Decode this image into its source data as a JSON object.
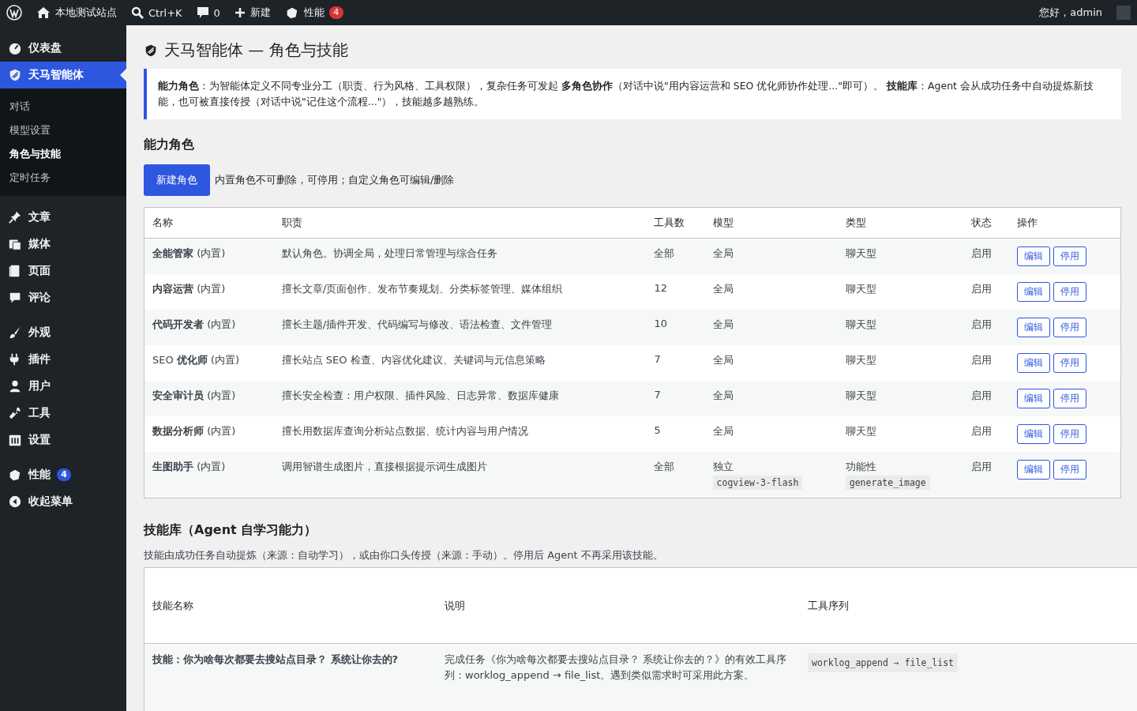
{
  "admin_bar": {
    "site_name": "本地测试站点",
    "search_shortcut": "Ctrl+K",
    "comments_count": "0",
    "new_label": "新建",
    "performance_label": "性能",
    "performance_badge": "4",
    "greeting": "您好，admin"
  },
  "sidebar": {
    "sections": [
      {
        "items": [
          {
            "label": "仪表盘",
            "selected": false
          },
          {
            "label": "天马智能体",
            "selected": true,
            "children": [
              {
                "label": "对话",
                "selected": false
              },
              {
                "label": "模型设置",
                "selected": false
              },
              {
                "label": "角色与技能",
                "selected": true
              },
              {
                "label": "定时任务",
                "selected": false
              }
            ]
          }
        ]
      },
      {
        "items": [
          {
            "label": "文章",
            "selected": false
          },
          {
            "label": "媒体",
            "selected": false
          },
          {
            "label": "页面",
            "selected": false
          },
          {
            "label": "评论",
            "selected": false
          }
        ]
      },
      {
        "items": [
          {
            "label": "外观",
            "selected": false
          },
          {
            "label": "插件",
            "selected": false
          },
          {
            "label": "用户",
            "selected": false
          },
          {
            "label": "工具",
            "selected": false
          },
          {
            "label": "设置",
            "selected": false
          }
        ]
      },
      {
        "items": [
          {
            "label": "性能",
            "selected": false,
            "badge": "4"
          },
          {
            "label": "收起菜单",
            "selected": false
          }
        ]
      }
    ]
  },
  "page": {
    "title": "天马智能体 — 角色与技能",
    "notice": "**能力角色**：为智能体定义不同专业分工（职责、行为风格、工具权限），复杂任务可发起 **多角色协作**（对话中说\"用内容运营和 SEO 优化师协作处理...\"即可）。 **技能库**：Agent 会从成功任务中自动提炼新技能，也可被直接传授（对话中说\"记住这个流程...\"），技能越多越熟练。",
    "roles_heading": "能力角色",
    "new_role_button": "新建角色",
    "roles_hint": "内置角色不可删除，可停用；自定义角色可编辑/删除",
    "roles_table": {
      "columns": [
        "名称",
        "职责",
        "工具数",
        "模型",
        "类型",
        "状态",
        "操作"
      ],
      "rows": [
        {
          "name": "**全能管家** (内置)",
          "duty": "默认角色。协调全局，处理日常管理与综合任务",
          "tools": "全部",
          "model": "全局",
          "type": "聊天型",
          "status": "启用",
          "edit": "编辑",
          "disable": "停用"
        },
        {
          "name": "**内容运营** (内置)",
          "duty": "擅长文章/页面创作、发布节奏规划、分类标签管理、媒体组织",
          "tools": "12",
          "model": "全局",
          "type": "聊天型",
          "status": "启用",
          "edit": "编辑",
          "disable": "停用"
        },
        {
          "name": "**代码开发者** (内置)",
          "duty": "擅长主题/插件开发、代码编写与修改、语法检查、文件管理",
          "tools": "10",
          "model": "全局",
          "type": "聊天型",
          "status": "启用",
          "edit": "编辑",
          "disable": "停用"
        },
        {
          "name": "SEO **优化师** (内置)",
          "duty": "擅长站点 SEO 检查、内容优化建议、关键词与元信息策略",
          "tools": "7",
          "model": "全局",
          "type": "聊天型",
          "status": "启用",
          "edit": "编辑",
          "disable": "停用"
        },
        {
          "name": "**安全审计员** (内置)",
          "duty": "擅长安全检查：用户权限、插件风险、日志异常、数据库健康",
          "tools": "7",
          "model": "全局",
          "type": "聊天型",
          "status": "启用",
          "edit": "编辑",
          "disable": "停用"
        },
        {
          "name": "**数据分析师** (内置)",
          "duty": "擅长用数据库查询分析站点数据、统计内容与用户情况",
          "tools": "5",
          "model": "全局",
          "type": "聊天型",
          "status": "启用",
          "edit": "编辑",
          "disable": "停用"
        },
        {
          "name": "**生图助手** (内置)",
          "duty": "调用智谱生成图片，直接根据提示词生成图片",
          "tools": "全部",
          "model": "独立",
          "model_code": "cogview-3-flash",
          "type": "功能性",
          "type_code": "generate_image",
          "status": "启用",
          "edit": "编辑",
          "disable": "停用"
        }
      ]
    },
    "skills_heading": "技能库（Agent 自学习能力）",
    "skills_hint": "技能由成功任务自动提炼（来源：自动学习），或由你口头传授（来源：手动）。停用后 Agent 不再采用该技能。",
    "skills_table": {
      "columns": [
        "技能名称",
        "说明",
        "工具序列"
      ],
      "rows": [
        {
          "name": "技能：你为啥每次都要去搜站点目录？ 系统让你去的?",
          "description": "完成任务《你为啥每次都要去搜站点目录？ 系统让你去的？》的有效工具序列：worklog_append → file_list。遇到类似需求时可采用此方案。",
          "sequence": "worklog_append → file_list"
        }
      ]
    }
  }
}
